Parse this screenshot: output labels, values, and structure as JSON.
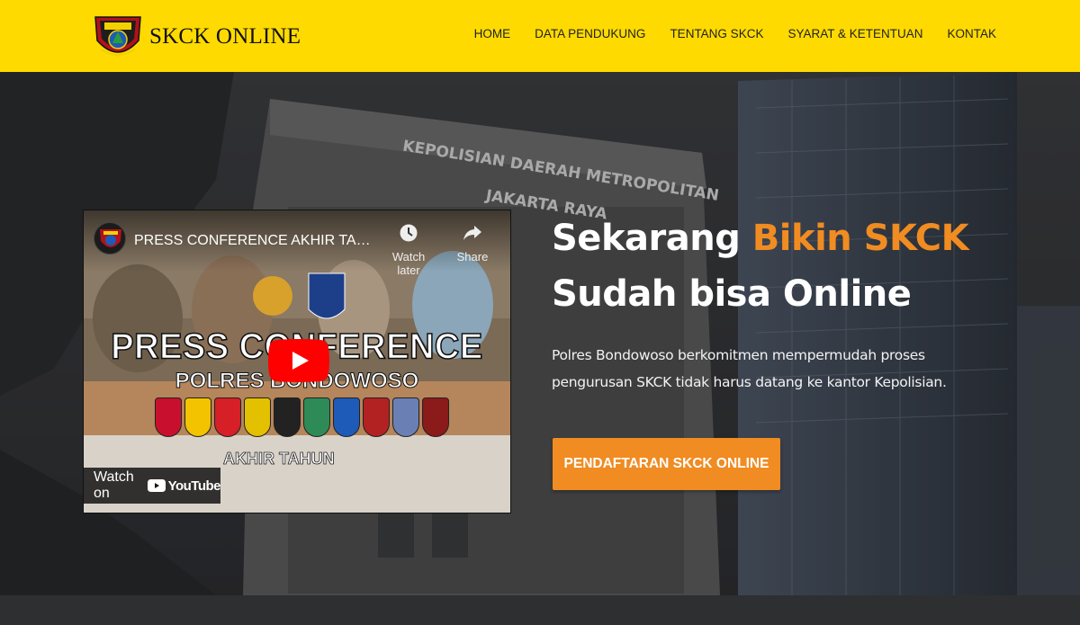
{
  "brand": {
    "name": "SKCK ONLINE",
    "logo_icon": "polres-bondowoso-logo-icon"
  },
  "nav": {
    "items": [
      {
        "label": "HOME"
      },
      {
        "label": "DATA PENDUKUNG"
      },
      {
        "label": "TENTANG SKCK"
      },
      {
        "label": "SYARAT & KETENTUAN"
      },
      {
        "label": "KONTAK"
      }
    ]
  },
  "hero": {
    "background_sign": [
      "KEPOLISIAN DAERAH METROPOLITAN",
      "JAKARTA RAYA"
    ],
    "headline": {
      "line1_prefix": "Sekarang ",
      "line1_accent": "Bikin SKCK",
      "line2_prefix": "Sudah bisa ",
      "line2_bold": "Online"
    },
    "description": "Polres Bondowoso berkomitmen mempermudah proses pengurusan SKCK tidak harus datang ke kantor Kepolisian.",
    "cta_label": "PENDAFTARAN SKCK ONLINE"
  },
  "video": {
    "title": "PRESS CONFERENCE AKHIR TAHU...",
    "watch_later_label": "Watch later",
    "share_label": "Share",
    "watch_on_label": "Watch on",
    "youtube_label": "YouTube",
    "thumbnail": {
      "line1": "PRESS CONFERENCE",
      "line2": "POLRES BONDOWOSO",
      "line3": "AKHIR TAHUN"
    }
  },
  "colors": {
    "nav_bg": "#ffda00",
    "accent": "#f08c22",
    "youtube_red": "#ff0000"
  }
}
